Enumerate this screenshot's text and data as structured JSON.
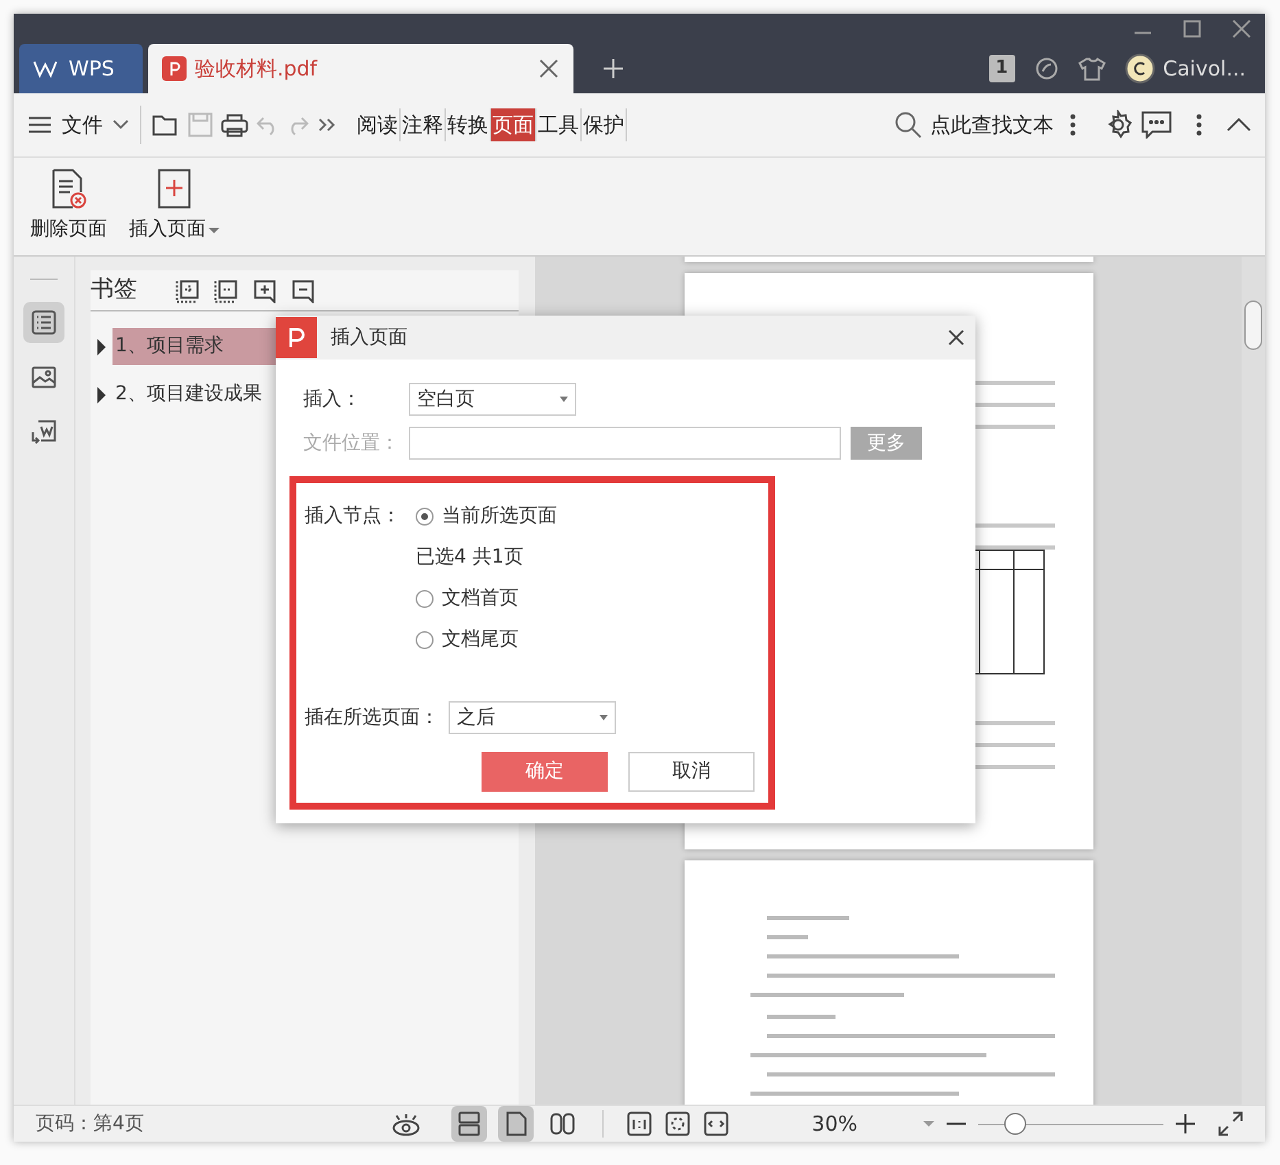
{
  "title_bar": {
    "tabs": [
      {
        "kind": "home",
        "label": "WPS",
        "selected": false
      },
      {
        "kind": "file",
        "label": "验收材料.pdf",
        "selected": true
      }
    ],
    "page_badge": "1",
    "user_name": "Caivol..."
  },
  "toolbar": {
    "file_menu": "文件",
    "tabs": [
      {
        "label": "阅读",
        "selected": false
      },
      {
        "label": "注释",
        "selected": false
      },
      {
        "label": "转换",
        "selected": false
      },
      {
        "label": "页面",
        "selected": true
      },
      {
        "label": "工具",
        "selected": false
      },
      {
        "label": "保护",
        "selected": false
      }
    ],
    "search": {
      "placeholder": "点此查找文本"
    }
  },
  "ribbon": {
    "buttons": [
      {
        "kind": "delete",
        "label": "删除页面",
        "dropdown": false
      },
      {
        "kind": "insert",
        "label": "插入页面",
        "dropdown": true
      }
    ]
  },
  "side_tabs": [
    {
      "kind": "outline",
      "selected": true
    },
    {
      "kind": "image",
      "selected": false
    },
    {
      "kind": "export",
      "selected": false
    }
  ],
  "bookmarks": {
    "title": "书签",
    "items": [
      {
        "label": "1、项目需求",
        "selected": true,
        "expanded": false
      },
      {
        "label": "2、项目建设成果",
        "selected": false,
        "expanded": false
      }
    ]
  },
  "dialog": {
    "title": "插入页面",
    "insert": {
      "label": "插入：",
      "value": "空白页"
    },
    "file_location": {
      "label": "文件位置：",
      "disabled": true,
      "button": "更多"
    },
    "node": {
      "label": "插入节点：",
      "options": [
        {
          "label": "当前所选页面",
          "selected": true
        },
        {
          "label": "文档首页",
          "selected": false
        },
        {
          "label": "文档尾页",
          "selected": false
        }
      ],
      "selection_info": "已选4 共1页"
    },
    "position": {
      "label": "插在所选页面：",
      "value": "之后"
    },
    "buttons": [
      {
        "kind": "primary",
        "label": "确定"
      },
      {
        "kind": "secondary",
        "label": "取消"
      }
    ],
    "highlight_frame": true
  },
  "status_bar": {
    "page": "页码：第4页",
    "view_modes": [
      {
        "kind": "continuous",
        "selected": true
      },
      {
        "kind": "single",
        "selected": true
      },
      {
        "kind": "double",
        "selected": false
      }
    ],
    "zoom": "30%",
    "zoom_slider": {
      "level": 0.2
    }
  }
}
